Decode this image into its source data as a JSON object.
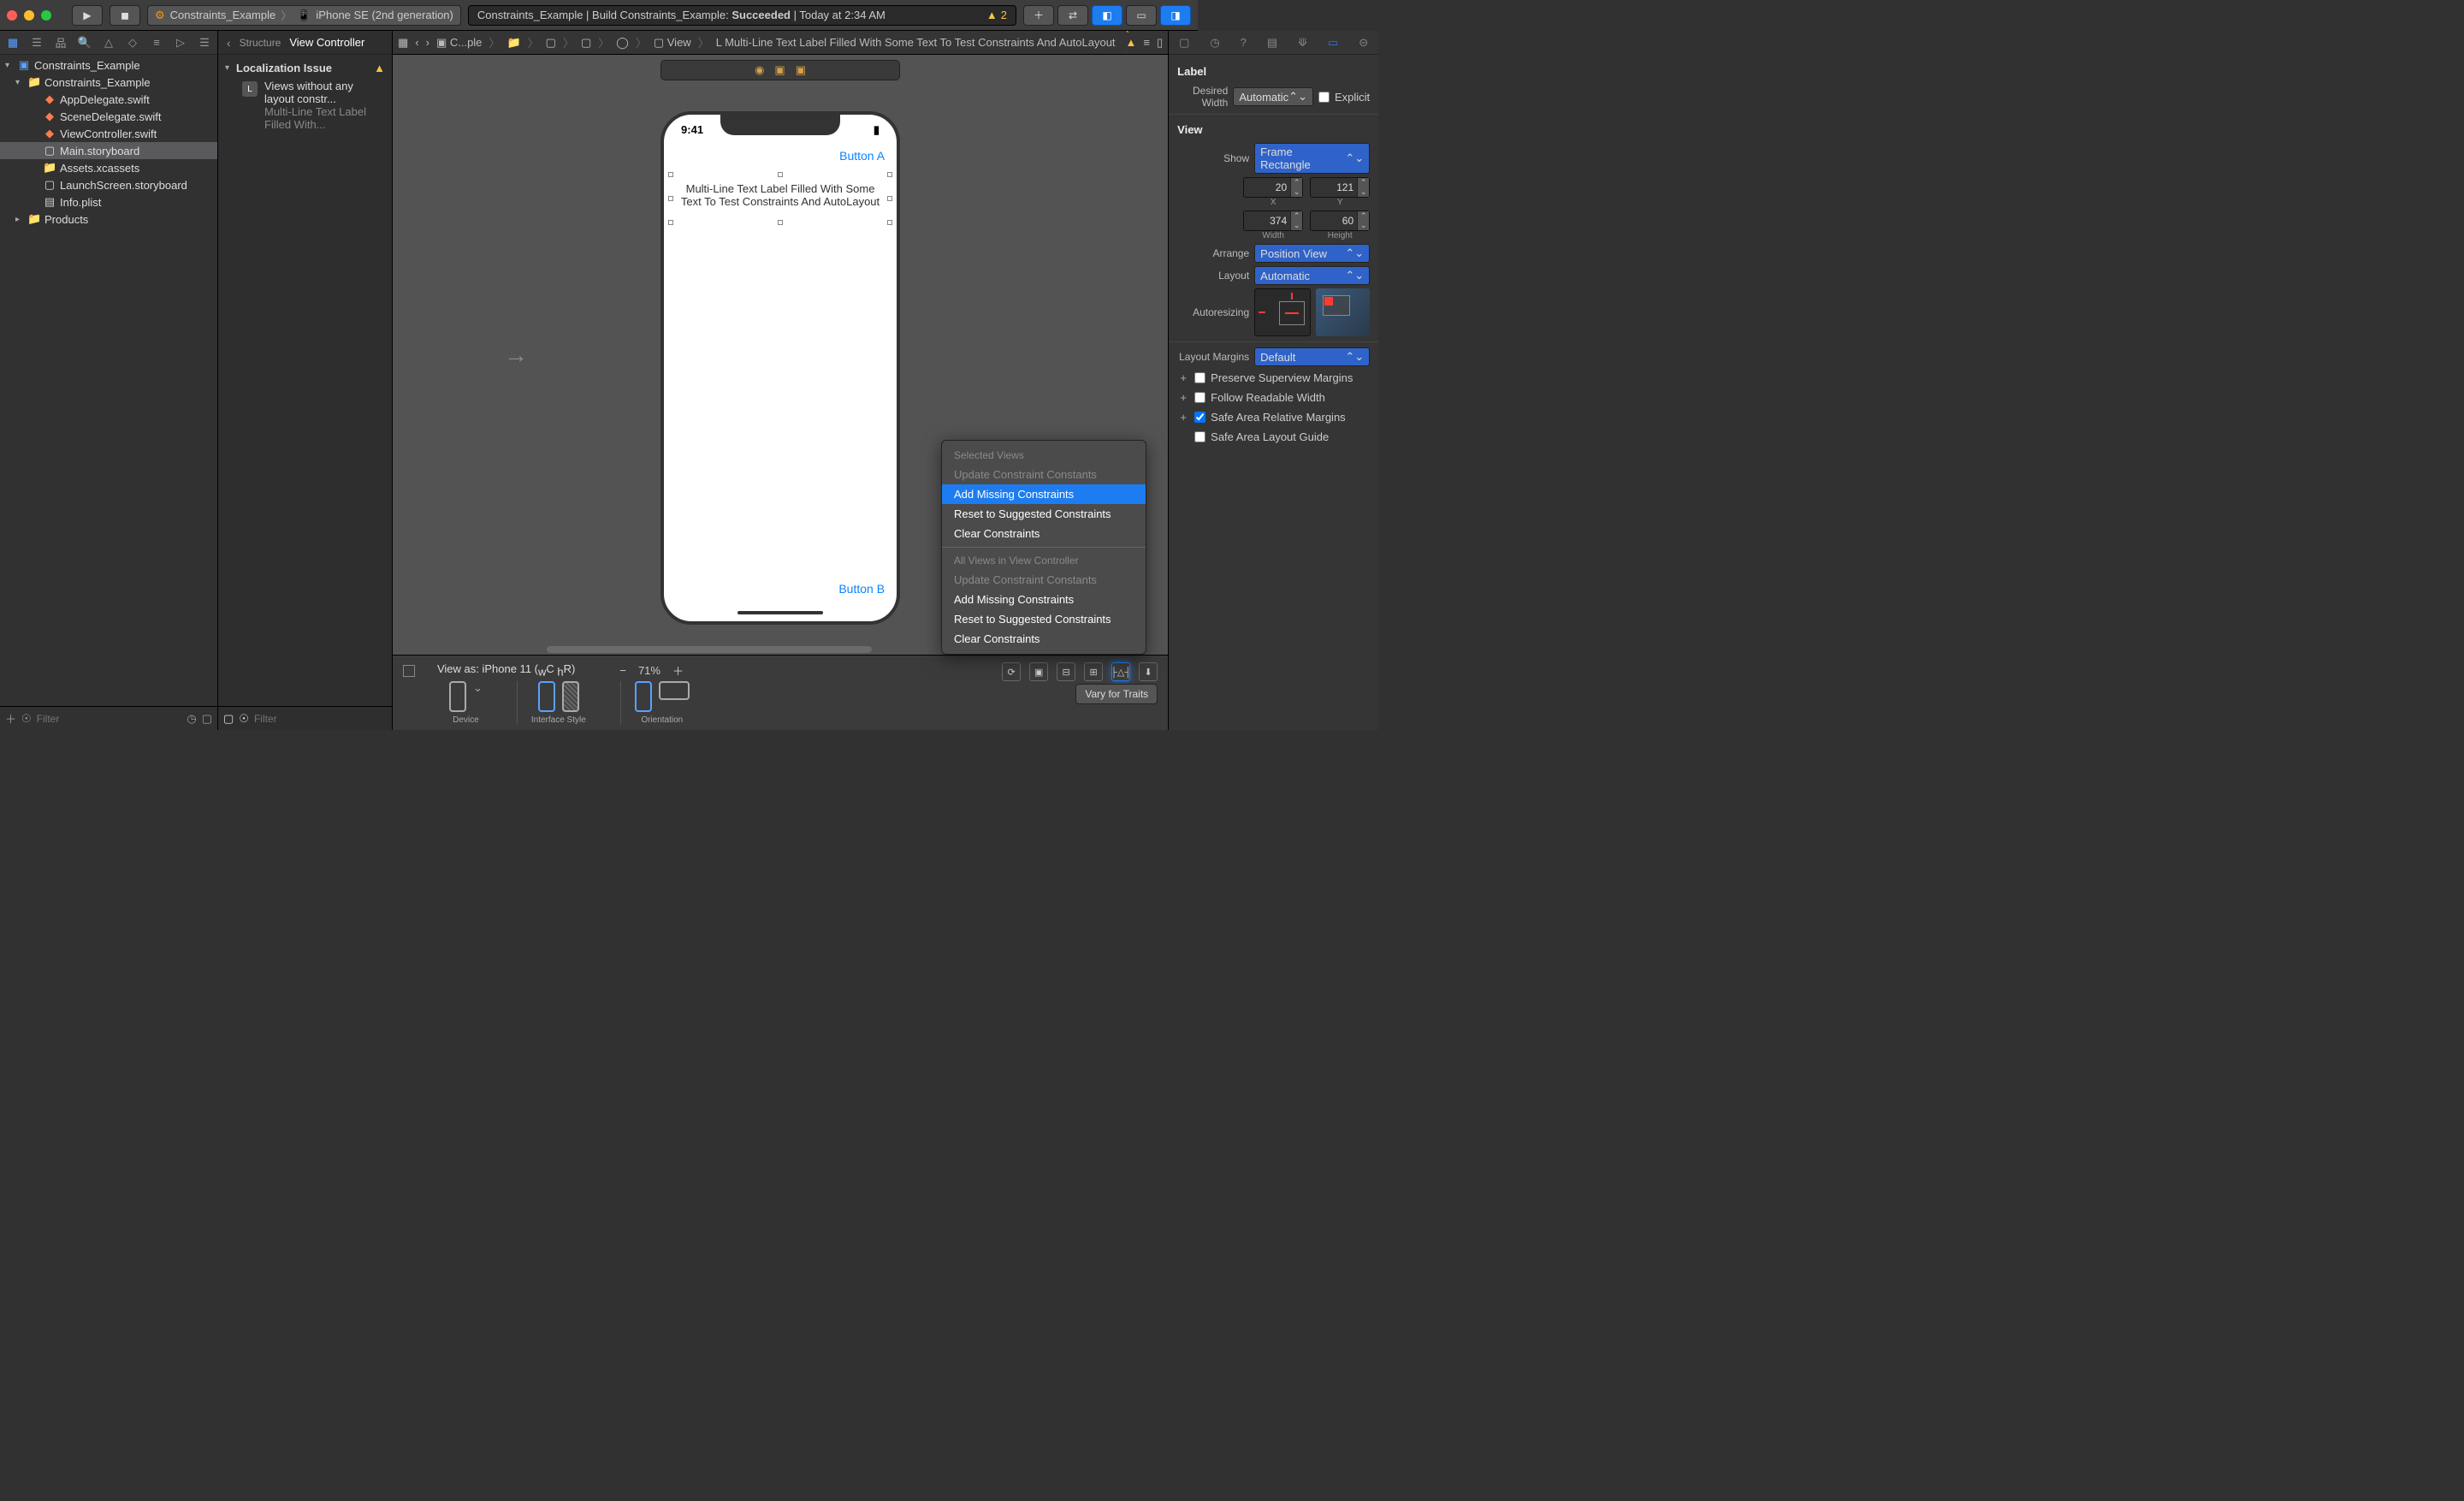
{
  "scheme": {
    "project": "Constraints_Example",
    "device": "iPhone SE (2nd generation)"
  },
  "status": {
    "text_prefix": "Constraints_Example | Build Constraints_Example: ",
    "text_bold": "Succeeded",
    "text_suffix": " | Today at 2:34 AM",
    "warnings": "2"
  },
  "navigator": {
    "root": "Constraints_Example",
    "group": "Constraints_Example",
    "files": [
      "AppDelegate.swift",
      "SceneDelegate.swift",
      "ViewController.swift",
      "Main.storyboard",
      "Assets.xcassets",
      "LaunchScreen.storyboard",
      "Info.plist"
    ],
    "products": "Products",
    "filter_placeholder": "Filter"
  },
  "outline": {
    "back": "Structure",
    "title": "View Controller",
    "group": "Localization Issue",
    "item_title": "Views without any layout constr...",
    "item_sub": "Multi-Line Text Label Filled With...",
    "filter_placeholder": "Filter"
  },
  "jumpbar": {
    "items": [
      "C...ple",
      "",
      "",
      "",
      "",
      "View",
      "Multi-Line Text Label Filled With Some Text To Test Constraints And AutoLayout"
    ]
  },
  "phone": {
    "time": "9:41",
    "button_a": "Button A",
    "button_b": "Button B",
    "label": "Multi-Line Text Label Filled With Some Text To Test Constraints And AutoLayout"
  },
  "bottombar": {
    "view_as": "View as: iPhone 11 (",
    "view_c": "C ",
    "view_r": "R)",
    "zoom": "71%",
    "device": "Device",
    "interface": "Interface Style",
    "orientation": "Orientation",
    "vary": "Vary for Traits"
  },
  "inspector": {
    "label_head": "Label",
    "desired": "Desired Width",
    "auto": "Automatic",
    "explicit": "Explicit",
    "view_head": "View",
    "show": "Show",
    "show_v": "Frame Rectangle",
    "x": "20",
    "xl": "X",
    "y": "121",
    "yl": "Y",
    "w": "374",
    "wl": "Width",
    "h": "60",
    "hl": "Height",
    "arrange": "Arrange",
    "arrange_v": "Position View",
    "layout": "Layout",
    "layout_v": "Automatic",
    "autoresize": "Autoresizing",
    "margins": "Layout Margins",
    "margins_v": "Default",
    "c1": "Preserve Superview Margins",
    "c2": "Follow Readable Width",
    "c3": "Safe Area Relative Margins",
    "c4": "Safe Area Layout Guide"
  },
  "popup": {
    "h1": "Selected Views",
    "i1": "Update Constraint Constants",
    "i2": "Add Missing Constraints",
    "i3": "Reset to Suggested Constraints",
    "i4": "Clear Constraints",
    "h2": "All Views in View Controller",
    "i5": "Update Constraint Constants",
    "i6": "Add Missing Constraints",
    "i7": "Reset to Suggested Constraints",
    "i8": "Clear Constraints"
  }
}
